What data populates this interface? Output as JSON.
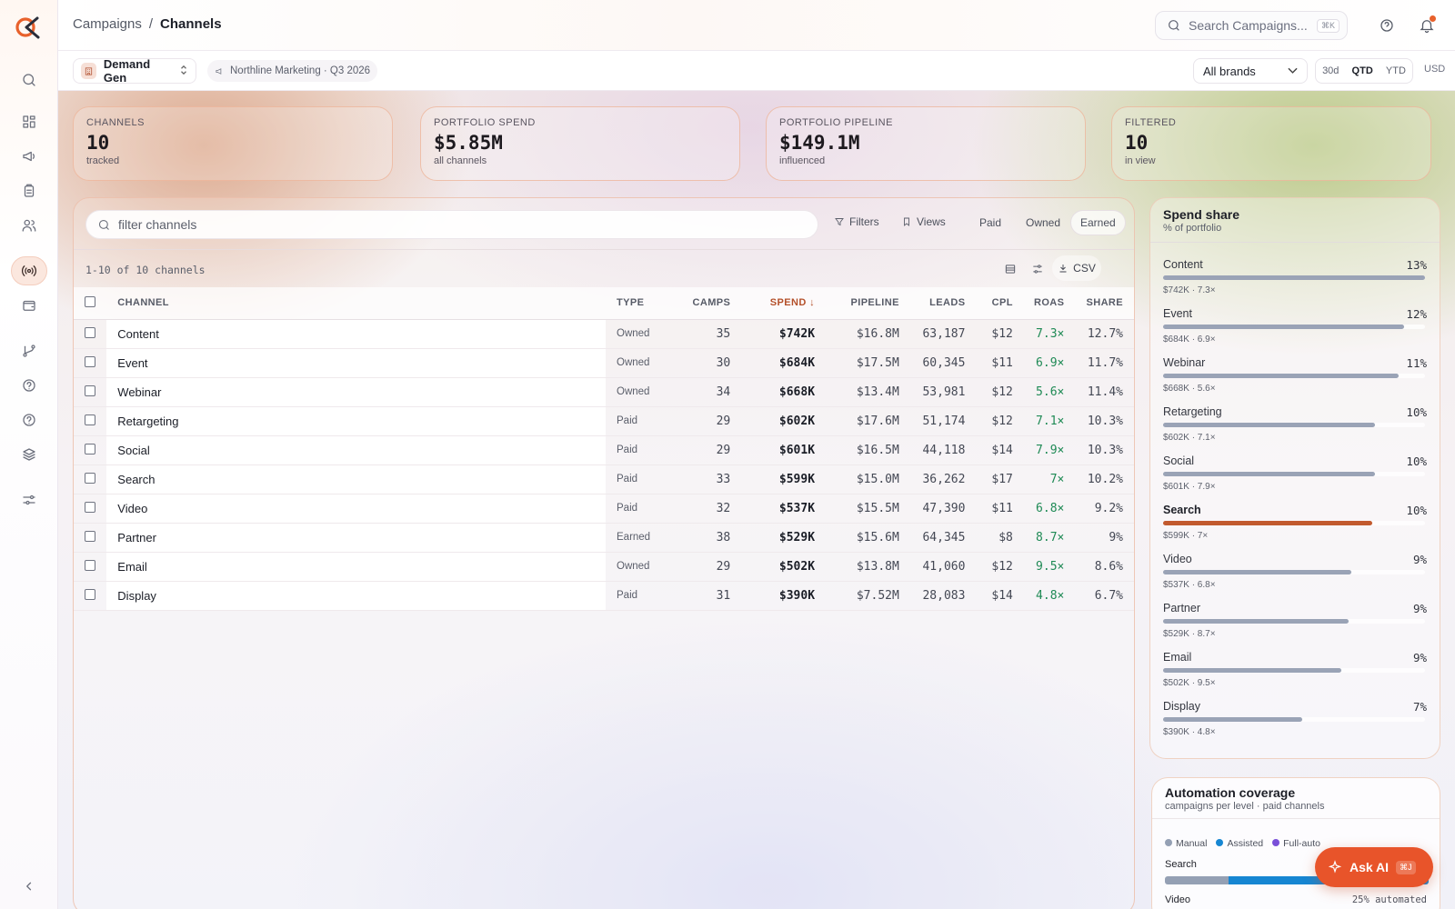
{
  "breadcrumb": {
    "parent": "Campaigns",
    "separator": "/",
    "current": "Channels"
  },
  "search": {
    "placeholder": "Search Campaigns...",
    "shortcut": "⌘K"
  },
  "workspace": {
    "name": "Demand Gen",
    "org": "Northline Marketing · Q3 2026"
  },
  "brand_filter": {
    "selected": "All brands"
  },
  "range": {
    "options": [
      "30d",
      "QTD",
      "YTD"
    ],
    "selected": "QTD",
    "currency": "USD"
  },
  "kpis": [
    {
      "label": "CHANNELS",
      "value": "10",
      "sub": "tracked"
    },
    {
      "label": "PORTFOLIO SPEND",
      "value": "$5.85M",
      "sub": "all channels"
    },
    {
      "label": "PORTFOLIO PIPELINE",
      "value": "$149.1M",
      "sub": "influenced"
    },
    {
      "label": "FILTERED",
      "value": "10",
      "sub": "in view"
    }
  ],
  "toolbar": {
    "filter_placeholder": "filter channels",
    "filters_label": "Filters",
    "views_label": "Views",
    "segments": [
      "Paid",
      "Owned",
      "Earned"
    ],
    "active_segment": "Earned",
    "count_text": "1-10 of 10 channels",
    "csv_label": "CSV"
  },
  "table": {
    "columns": [
      "CHANNEL",
      "TYPE",
      "CAMPS",
      "SPEND",
      "PIPELINE",
      "LEADS",
      "CPL",
      "ROAS",
      "SHARE"
    ],
    "sorted_column": "SPEND",
    "rows": [
      {
        "channel": "Content",
        "type": "Owned",
        "camps": "35",
        "spend": "$742K",
        "pipeline": "$16.8M",
        "leads": "63,187",
        "cpl": "$12",
        "roas": "7.3×",
        "share": "12.7%"
      },
      {
        "channel": "Event",
        "type": "Owned",
        "camps": "30",
        "spend": "$684K",
        "pipeline": "$17.5M",
        "leads": "60,345",
        "cpl": "$11",
        "roas": "6.9×",
        "share": "11.7%"
      },
      {
        "channel": "Webinar",
        "type": "Owned",
        "camps": "34",
        "spend": "$668K",
        "pipeline": "$13.4M",
        "leads": "53,981",
        "cpl": "$12",
        "roas": "5.6×",
        "share": "11.4%"
      },
      {
        "channel": "Retargeting",
        "type": "Paid",
        "camps": "29",
        "spend": "$602K",
        "pipeline": "$17.6M",
        "leads": "51,174",
        "cpl": "$12",
        "roas": "7.1×",
        "share": "10.3%"
      },
      {
        "channel": "Social",
        "type": "Paid",
        "camps": "29",
        "spend": "$601K",
        "pipeline": "$16.5M",
        "leads": "44,118",
        "cpl": "$14",
        "roas": "7.9×",
        "share": "10.3%"
      },
      {
        "channel": "Search",
        "type": "Paid",
        "camps": "33",
        "spend": "$599K",
        "pipeline": "$15.0M",
        "leads": "36,262",
        "cpl": "$17",
        "roas": "7×",
        "share": "10.2%"
      },
      {
        "channel": "Video",
        "type": "Paid",
        "camps": "32",
        "spend": "$537K",
        "pipeline": "$15.5M",
        "leads": "47,390",
        "cpl": "$11",
        "roas": "6.8×",
        "share": "9.2%"
      },
      {
        "channel": "Partner",
        "type": "Earned",
        "camps": "38",
        "spend": "$529K",
        "pipeline": "$15.6M",
        "leads": "64,345",
        "cpl": "$8",
        "roas": "8.7×",
        "share": "9%"
      },
      {
        "channel": "Email",
        "type": "Owned",
        "camps": "29",
        "spend": "$502K",
        "pipeline": "$13.8M",
        "leads": "41,060",
        "cpl": "$12",
        "roas": "9.5×",
        "share": "8.6%"
      },
      {
        "channel": "Display",
        "type": "Paid",
        "camps": "31",
        "spend": "$390K",
        "pipeline": "$7.52M",
        "leads": "28,083",
        "cpl": "$14",
        "roas": "4.8×",
        "share": "6.7%"
      }
    ]
  },
  "spend_share": {
    "title": "Spend share",
    "subtitle": "% of portfolio",
    "highlighted": "Search",
    "items": [
      {
        "name": "Content",
        "pct": "13%",
        "meta": "$742K · 7.3×",
        "level": 1.0
      },
      {
        "name": "Event",
        "pct": "12%",
        "meta": "$684K · 6.9×",
        "level": 0.92
      },
      {
        "name": "Webinar",
        "pct": "11%",
        "meta": "$668K · 5.6×",
        "level": 0.9
      },
      {
        "name": "Retargeting",
        "pct": "10%",
        "meta": "$602K · 7.1×",
        "level": 0.81
      },
      {
        "name": "Social",
        "pct": "10%",
        "meta": "$601K · 7.9×",
        "level": 0.81
      },
      {
        "name": "Search",
        "pct": "10%",
        "meta": "$599K · 7×",
        "level": 0.8
      },
      {
        "name": "Video",
        "pct": "9%",
        "meta": "$537K · 6.8×",
        "level": 0.72
      },
      {
        "name": "Partner",
        "pct": "9%",
        "meta": "$529K · 8.7×",
        "level": 0.71
      },
      {
        "name": "Email",
        "pct": "9%",
        "meta": "$502K · 9.5×",
        "level": 0.68
      },
      {
        "name": "Display",
        "pct": "7%",
        "meta": "$390K · 4.8×",
        "level": 0.53
      }
    ]
  },
  "automation": {
    "title": "Automation coverage",
    "subtitle": "campaigns per level · paid channels",
    "legend": [
      {
        "name": "Manual",
        "color": "#94a0b4"
      },
      {
        "name": "Assisted",
        "color": "#1686d2"
      },
      {
        "name": "Full-auto",
        "color": "#7a4fd8"
      }
    ],
    "rows": [
      {
        "name": "Search",
        "value": ""
      },
      {
        "name": "Video",
        "value": "25% automated"
      }
    ]
  },
  "ask_ai": {
    "label": "Ask AI",
    "shortcut": "⌘J"
  }
}
